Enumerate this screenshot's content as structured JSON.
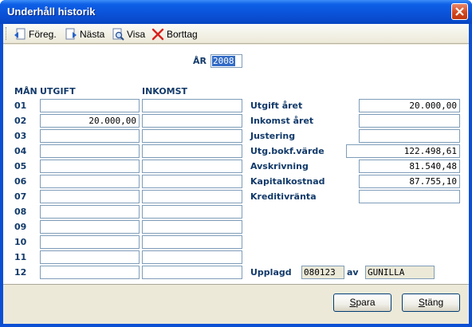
{
  "window": {
    "title": "Underhåll historik"
  },
  "toolbar": {
    "items": [
      {
        "label": "Föreg.",
        "icon": "doc-prev-icon"
      },
      {
        "label": "Nästa",
        "icon": "doc-next-icon"
      },
      {
        "label": "Visa",
        "icon": "doc-view-icon"
      },
      {
        "label": "Borttag",
        "icon": "red-x-icon"
      }
    ]
  },
  "year": {
    "label": "ÅR",
    "value": "2008"
  },
  "table": {
    "headers": {
      "month": "MÅN",
      "expense": "UTGIFT",
      "income": "INKOMST"
    },
    "rows": [
      {
        "month": "01",
        "expense": "",
        "income": ""
      },
      {
        "month": "02",
        "expense": "20.000,00",
        "income": ""
      },
      {
        "month": "03",
        "expense": "",
        "income": ""
      },
      {
        "month": "04",
        "expense": "",
        "income": ""
      },
      {
        "month": "05",
        "expense": "",
        "income": ""
      },
      {
        "month": "06",
        "expense": "",
        "income": ""
      },
      {
        "month": "07",
        "expense": "",
        "income": ""
      },
      {
        "month": "08",
        "expense": "",
        "income": ""
      },
      {
        "month": "09",
        "expense": "",
        "income": ""
      },
      {
        "month": "10",
        "expense": "",
        "income": ""
      },
      {
        "month": "11",
        "expense": "",
        "income": ""
      },
      {
        "month": "12",
        "expense": "",
        "income": ""
      }
    ]
  },
  "summary": {
    "expense_year": {
      "label": "Utgift året",
      "value": "20.000,00"
    },
    "income_year": {
      "label": "Inkomst året",
      "value": ""
    },
    "adjustment": {
      "label": "Justering",
      "value": ""
    },
    "book_value": {
      "label": "Utg.bokf.värde",
      "value": "122.498,61"
    },
    "depreciation": {
      "label": "Avskrivning",
      "value": "81.540,48"
    },
    "capital_cost": {
      "label": "Kapitalkostnad",
      "value": "87.755,10"
    },
    "credit_rate": {
      "label": "Kreditivränta",
      "value": ""
    }
  },
  "created": {
    "label": "Upplagd",
    "date": "080123",
    "by_label": "av",
    "user": "GUNILLA"
  },
  "buttons": {
    "save_prefix": "S",
    "save_rest": "para",
    "close_prefix": "S",
    "close_rest": "täng"
  },
  "colors": {
    "titlebar": "#0a52d8",
    "label": "#123a6a",
    "field_border": "#7f9db9",
    "selection": "#316ac5"
  }
}
